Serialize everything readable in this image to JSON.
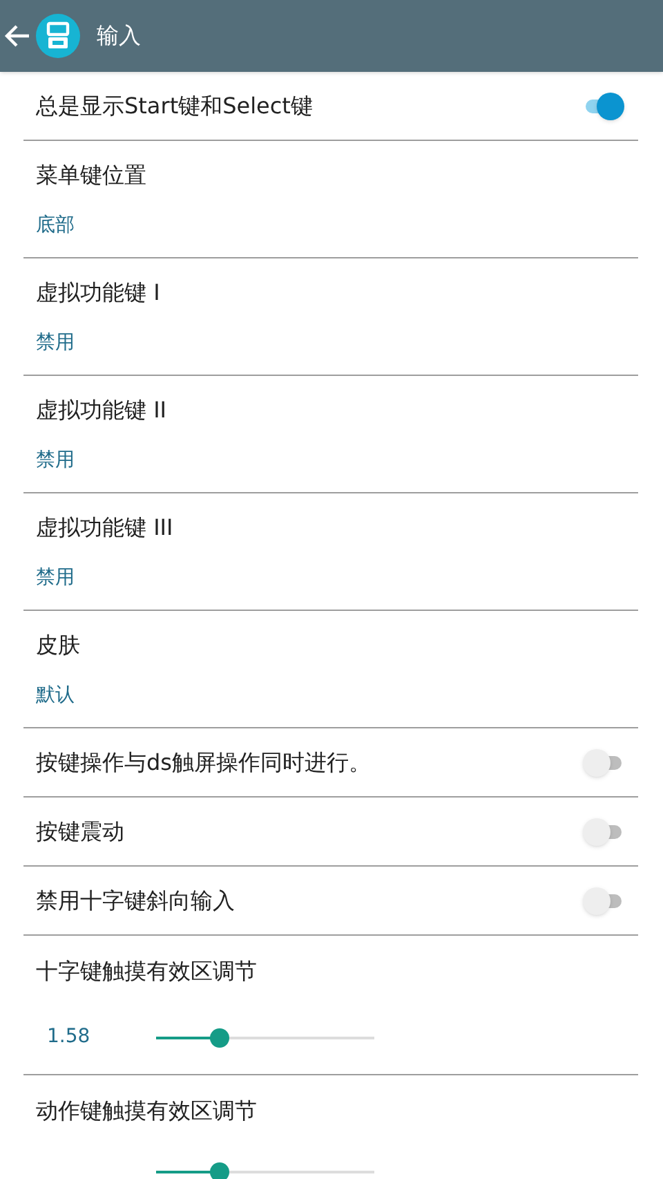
{
  "app_bar": {
    "title": "输入"
  },
  "settings": [
    {
      "kind": "switch",
      "title": "总是显示Start键和Select键",
      "on": true
    },
    {
      "kind": "choice",
      "title": "菜单键位置",
      "value": "底部"
    },
    {
      "kind": "choice",
      "title": "虚拟功能键 I",
      "value": "禁用"
    },
    {
      "kind": "choice",
      "title": "虚拟功能键 II",
      "value": "禁用"
    },
    {
      "kind": "choice",
      "title": "虚拟功能键 III",
      "value": "禁用"
    },
    {
      "kind": "choice",
      "title": "皮肤",
      "value": "默认"
    },
    {
      "kind": "switch",
      "title": "按键操作与ds触屏操作同时进行。",
      "on": false
    },
    {
      "kind": "switch",
      "title": "按键震动",
      "on": false
    },
    {
      "kind": "switch",
      "title": "禁用十字键斜向输入",
      "on": false
    },
    {
      "kind": "slider",
      "title": "十字键触摸有效区调节",
      "reading": "1.58",
      "level": 0.29
    },
    {
      "kind": "slider",
      "title": "动作键触摸有效区调节",
      "level": 0.29
    }
  ]
}
